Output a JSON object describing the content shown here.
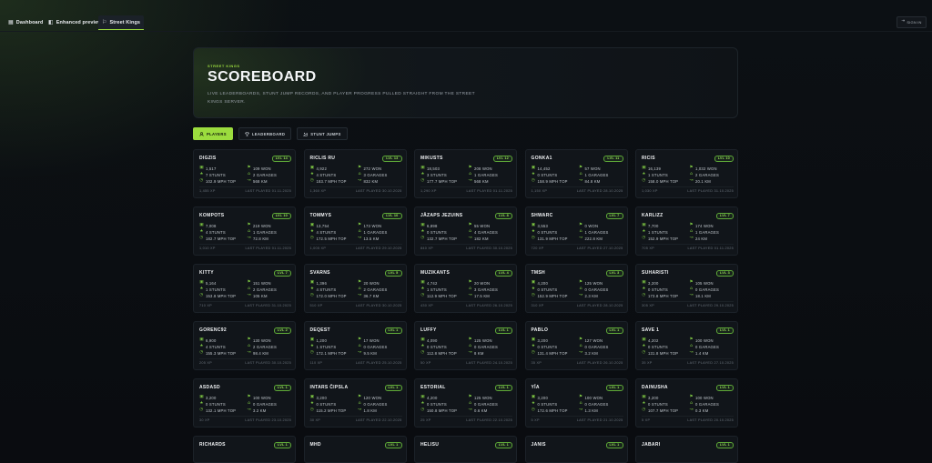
{
  "topbar": {
    "tabs": [
      {
        "label": "Dashboard",
        "icon": "grid-icon"
      },
      {
        "label": "Enhanced preview",
        "icon": "preview-icon"
      },
      {
        "label": "Street Kings",
        "icon": "flag-icon",
        "active": true
      }
    ],
    "sign_in_label": "SIGN IN",
    "sign_in_icon": "login-icon"
  },
  "hero": {
    "eyebrow": "STREET KINGS",
    "title": "SCOREBOARD",
    "subtitle": "LIVE LEADERBOARDS, STUNT JUMP RECORDS, AND PLAYER PROGRESS PULLED STRAIGHT FROM THE STREET KINGS SERVER."
  },
  "view_tabs": [
    {
      "label": "PLAYERS",
      "icon": "users-icon",
      "active": true
    },
    {
      "label": "LEADERBOARD",
      "icon": "trophy-icon"
    },
    {
      "label": "STUNT JUMPS",
      "icon": "ramp-icon"
    }
  ],
  "stat_icons": {
    "money": "cash-icon",
    "wins": "flag-icon",
    "stunts": "star-icon",
    "garages": "garage-icon",
    "top_speed": "speedometer-icon",
    "distance": "route-icon"
  },
  "colors": {
    "accent": "#9bdc3e",
    "background": "#0b0e12",
    "card": "#11151a",
    "badge": "#9be05a"
  },
  "players": [
    {
      "name": "DIGZIS",
      "level": "LVL 14",
      "money": "1,517",
      "wins": "109 WON",
      "stunts": "7 STUNTS",
      "garages": "2 GARAGES",
      "top_speed": "102.9 MPH TOP",
      "distance": "568 KM",
      "xp": "1,455 XP",
      "last_played": "LAST PLAYED 01.11.2025"
    },
    {
      "name": "RICLIS RU",
      "level": "LVL 13",
      "money": "4,922",
      "wins": "272 WON",
      "stunts": "4 STUNTS",
      "garages": "3 GARAGES",
      "top_speed": "183.7 MPH TOP",
      "distance": "832 KM",
      "xp": "1,360 XP",
      "last_played": "LAST PLAYED 30.10.2025"
    },
    {
      "name": "MIKUSTS",
      "level": "LVL 12",
      "money": "18,503",
      "wins": "208 WON",
      "stunts": "3 STUNTS",
      "garages": "1 GARAGES",
      "top_speed": "177.7 MPH TOP",
      "distance": "568 KM",
      "xp": "1,290 XP",
      "last_played": "LAST PLAYED 01.11.2025"
    },
    {
      "name": "GONKA1",
      "level": "LVL 11",
      "money": "14,452",
      "wins": "57 WON",
      "stunts": "0 STUNTS",
      "garages": "1 GARAGES",
      "top_speed": "158.9 MPH TOP",
      "distance": "84.8 KM",
      "xp": "1,150 XP",
      "last_played": "LAST PLAYED 28.10.2025"
    },
    {
      "name": "RICIS",
      "level": "LVL 10",
      "money": "16,139",
      "wins": "1,032 WON",
      "stunts": "1 STUNTS",
      "garages": "2 GARAGES",
      "top_speed": "158.0 MPH TOP",
      "distance": "20.1 KM",
      "xp": "1,030 XP",
      "last_played": "LAST PLAYED 31.10.2025"
    },
    {
      "name": "KOMPOTS",
      "level": "LVL 10",
      "money": "7,008",
      "wins": "219 WON",
      "stunts": "4 STUNTS",
      "garages": "1 GARAGES",
      "top_speed": "182.7 MPH TOP",
      "distance": "72.8 KM",
      "xp": "1,010 XP",
      "last_played": "LAST PLAYED 01.11.2025"
    },
    {
      "name": "TOMMYS",
      "level": "LVL 10",
      "money": "13,754",
      "wins": "173 WON",
      "stunts": "4 STUNTS",
      "garages": "1 GARAGES",
      "top_speed": "172.5 MPH TOP",
      "distance": "13.5 KM",
      "xp": "1,005 XP",
      "last_played": "LAST PLAYED 29.10.2025"
    },
    {
      "name": "JĀZAPS JEZUINS",
      "level": "LVL 8",
      "money": "6,898",
      "wins": "55 WON",
      "stunts": "0 STUNTS",
      "garages": "4 GARAGES",
      "top_speed": "132.7 MPH TOP",
      "distance": "182 KM",
      "xp": "840 XP",
      "last_played": "LAST PLAYED 30.10.2025"
    },
    {
      "name": "SHWARC",
      "level": "LVL 7",
      "money": "3,553",
      "wins": "0 WON",
      "stunts": "0 STUNTS",
      "garages": "1 GARAGES",
      "top_speed": "131.9 MPH TOP",
      "distance": "222.8 KM",
      "xp": "720 XP",
      "last_played": "LAST PLAYED 27.10.2025"
    },
    {
      "name": "KARLIZZ",
      "level": "LVL 7",
      "money": "7,700",
      "wins": "174 WON",
      "stunts": "1 STUNTS",
      "garages": "1 GARAGES",
      "top_speed": "152.9 MPH TOP",
      "distance": "24 KM",
      "xp": "705 XP",
      "last_played": "LAST PLAYED 01.11.2025"
    },
    {
      "name": "KITTY",
      "level": "LVL 7",
      "money": "5,164",
      "wins": "151 WON",
      "stunts": "1 STUNTS",
      "garages": "2 GARAGES",
      "top_speed": "153.8 MPH TOP",
      "distance": "105 KM",
      "xp": "710 XP",
      "last_played": "LAST PLAYED 31.10.2025"
    },
    {
      "name": "SVARNS",
      "level": "LVL 5",
      "money": "1,396",
      "wins": "20 WON",
      "stunts": "4 STUNTS",
      "garages": "2 GARAGES",
      "top_speed": "172.0 MPH TOP",
      "distance": "36.7 KM",
      "xp": "510 XP",
      "last_played": "LAST PLAYED 30.10.2025"
    },
    {
      "name": "MUZIKANTS",
      "level": "LVL 4",
      "money": "4,742",
      "wins": "20 WON",
      "stunts": "1 STUNTS",
      "garages": "3 GARAGES",
      "top_speed": "112.9 MPH TOP",
      "distance": "17.5 KM",
      "xp": "430 XP",
      "last_played": "LAST PLAYED 26.10.2025"
    },
    {
      "name": "TMSH",
      "level": "LVL 3",
      "money": "4,200",
      "wins": "125 WON",
      "stunts": "0 STUNTS",
      "garages": "0 GARAGES",
      "top_speed": "152.9 MPH TOP",
      "distance": "2.3 KM",
      "xp": "310 XP",
      "last_played": "LAST PLAYED 28.10.2025"
    },
    {
      "name": "SUHARISTI",
      "level": "LVL 3",
      "money": "3,200",
      "wins": "105 WON",
      "stunts": "0 STUNTS",
      "garages": "0 GARAGES",
      "top_speed": "173.8 MPH TOP",
      "distance": "18.1 KM",
      "xp": "305 XP",
      "last_played": "LAST PLAYED 29.10.2025"
    },
    {
      "name": "GORENC92",
      "level": "LVL 2",
      "money": "6,900",
      "wins": "130 WON",
      "stunts": "4 STUNTS",
      "garages": "2 GARAGES",
      "top_speed": "155.3 MPH TOP",
      "distance": "98.4 KM",
      "xp": "205 XP",
      "last_played": "LAST PLAYED 30.10.2025"
    },
    {
      "name": "DEQEST",
      "level": "LVL 1",
      "money": "1,200",
      "wins": "17 WON",
      "stunts": "1 STUNTS",
      "garages": "0 GARAGES",
      "top_speed": "172.1 MPH TOP",
      "distance": "9.5 KM",
      "xp": "110 XP",
      "last_played": "LAST PLAYED 25.10.2025"
    },
    {
      "name": "LUFFY",
      "level": "LVL 1",
      "money": "4,090",
      "wins": "125 WON",
      "stunts": "0 STUNTS",
      "garages": "0 GARAGES",
      "top_speed": "112.8 MPH TOP",
      "distance": "8 KM",
      "xp": "50 XP",
      "last_played": "LAST PLAYED 24.10.2025"
    },
    {
      "name": "PABLO",
      "level": "LVL 1",
      "money": "3,200",
      "wins": "127 WON",
      "stunts": "0 STUNTS",
      "garages": "0 GARAGES",
      "top_speed": "131.4 MPH TOP",
      "distance": "3.2 KM",
      "xp": "35 XP",
      "last_played": "LAST PLAYED 26.10.2025"
    },
    {
      "name": "SAVE 1",
      "level": "LVL 1",
      "money": "4,202",
      "wins": "100 WON",
      "stunts": "0 STUNTS",
      "garages": "0 GARAGES",
      "top_speed": "131.8 MPH TOP",
      "distance": "1.4 KM",
      "xp": "35 XP",
      "last_played": "LAST PLAYED 27.10.2025"
    },
    {
      "name": "ASDASD",
      "level": "LVL 1",
      "money": "3,200",
      "wins": "100 WON",
      "stunts": "0 STUNTS",
      "garages": "0 GARAGES",
      "top_speed": "132.1 MPH TOP",
      "distance": "3.2 KM",
      "xp": "30 XP",
      "last_played": "LAST PLAYED 23.10.2025"
    },
    {
      "name": "INTARS ČIPSLA",
      "level": "LVL 1",
      "money": "3,200",
      "wins": "120 WON",
      "stunts": "0 STUNTS",
      "garages": "0 GARAGES",
      "top_speed": "115.2 MPH TOP",
      "distance": "1.8 KM",
      "xp": "30 XP",
      "last_played": "LAST PLAYED 22.10.2025"
    },
    {
      "name": "ESTORIAL",
      "level": "LVL 1",
      "money": "4,200",
      "wins": "125 WON",
      "stunts": "0 STUNTS",
      "garages": "0 GARAGES",
      "top_speed": "150.8 MPH TOP",
      "distance": "0.6 KM",
      "xp": "25 XP",
      "last_played": "LAST PLAYED 22.10.2025"
    },
    {
      "name": "YĪA",
      "level": "LVL 1",
      "money": "3,200",
      "wins": "100 WON",
      "stunts": "0 STUNTS",
      "garages": "0 GARAGES",
      "top_speed": "172.6 MPH TOP",
      "distance": "1.3 KM",
      "xp": "5 XP",
      "last_played": "LAST PLAYED 21.10.2025"
    },
    {
      "name": "DAINUSHA",
      "level": "LVL 1",
      "money": "3,200",
      "wins": "100 WON",
      "stunts": "0 STUNTS",
      "garages": "0 GARAGES",
      "top_speed": "107.7 MPH TOP",
      "distance": "0.3 KM",
      "xp": "5 XP",
      "last_played": "LAST PLAYED 20.10.2025"
    },
    {
      "name": "RICHARDS",
      "level": "LVL 1"
    },
    {
      "name": "MHD",
      "level": "LVL 1"
    },
    {
      "name": "HELISU",
      "level": "LVL 1"
    },
    {
      "name": "JANIS",
      "level": "LVL 1"
    },
    {
      "name": "JABARI",
      "level": "LVL 1"
    }
  ]
}
